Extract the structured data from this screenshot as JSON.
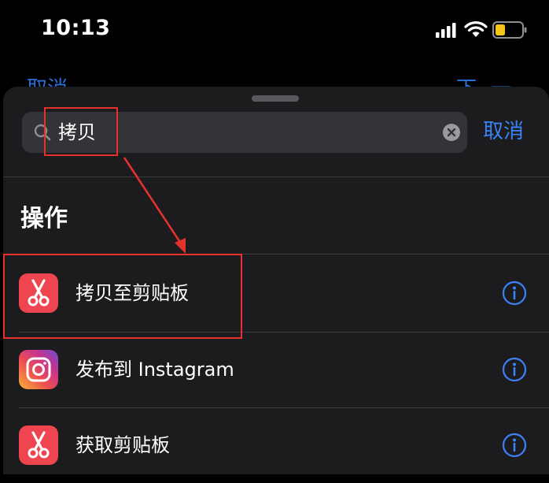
{
  "status_bar": {
    "time": "10:13",
    "signal_icon": "cellular-signal-icon",
    "wifi_icon": "wifi-icon",
    "battery_icon": "battery-low-icon",
    "battery_color": "#f5c518"
  },
  "background_nav": {
    "left_label": "取消",
    "right_label": "下一步"
  },
  "search": {
    "value": "拷贝",
    "cancel_label": "取消"
  },
  "section": {
    "title": "操作"
  },
  "actions": [
    {
      "label": "拷贝至剪贴板",
      "icon": "scissors-icon",
      "icon_color": "#ee4550"
    },
    {
      "label": "发布到 Instagram",
      "icon": "instagram-icon"
    },
    {
      "label": "获取剪贴板",
      "icon": "scissors-icon",
      "icon_color": "#ee4550"
    }
  ],
  "colors": {
    "accent": "#3a82f7",
    "sheet_background": "#1c1c1e",
    "annotation": "#e5322d"
  }
}
